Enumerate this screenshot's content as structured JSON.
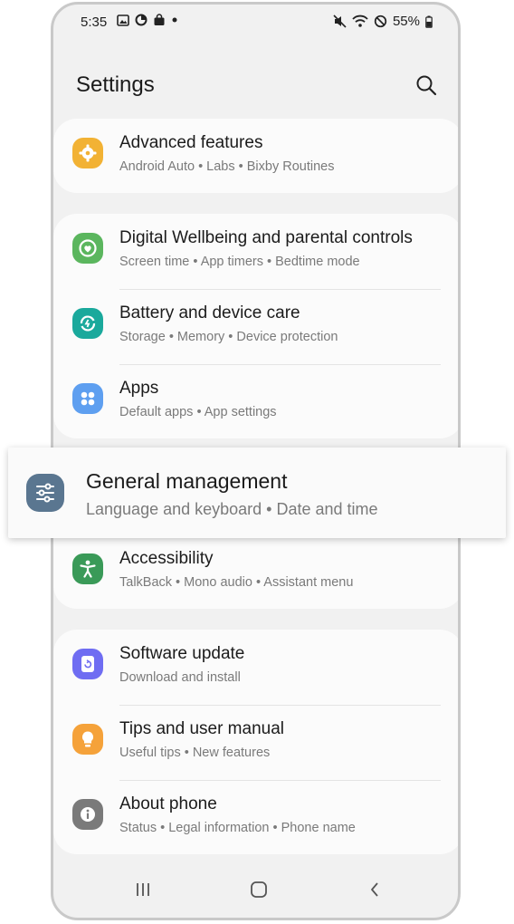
{
  "status": {
    "time": "5:35",
    "battery": "55%",
    "left_icons": [
      "gallery-icon",
      "data-saver-icon",
      "bag-icon",
      "dot-icon"
    ],
    "right_icons": [
      "mute-icon",
      "wifi-icon",
      "block-icon",
      "battery-icon"
    ]
  },
  "header": {
    "title": "Settings"
  },
  "items": [
    {
      "title": "Advanced features",
      "subtitle": "Android Auto  •  Labs  •  Bixby Routines",
      "color": "#f2b234",
      "icon": "gear-plus-icon"
    },
    {
      "title": "Digital Wellbeing and parental controls",
      "subtitle": "Screen time  •  App timers  •  Bedtime mode",
      "color": "#5bb65e",
      "icon": "wellbeing-icon"
    },
    {
      "title": "Battery and device care",
      "subtitle": "Storage  •  Memory  •  Device protection",
      "color": "#1aa99c",
      "icon": "device-care-icon"
    },
    {
      "title": "Apps",
      "subtitle": "Default apps  •  App settings",
      "color": "#5e9ff0",
      "icon": "apps-grid-icon"
    },
    {
      "title": "Accessibility",
      "subtitle": "TalkBack  •  Mono audio  •  Assistant menu",
      "color": "#3a9a58",
      "icon": "accessibility-icon"
    },
    {
      "title": "Software update",
      "subtitle": "Download and install",
      "color": "#6f6df2",
      "icon": "software-update-icon"
    },
    {
      "title": "Tips and user manual",
      "subtitle": "Useful tips  •  New features",
      "color": "#f5a23a",
      "icon": "lightbulb-icon"
    },
    {
      "title": "About phone",
      "subtitle": "Status  •  Legal information  •  Phone name",
      "color": "#7a7a7a",
      "icon": "info-icon"
    }
  ],
  "highlight": {
    "title": "General management",
    "subtitle": "Language and keyboard  •  Date and time",
    "color": "#5a7690",
    "icon": "sliders-icon"
  },
  "nav": {
    "icons": [
      "recents-icon",
      "home-icon",
      "back-icon"
    ]
  }
}
